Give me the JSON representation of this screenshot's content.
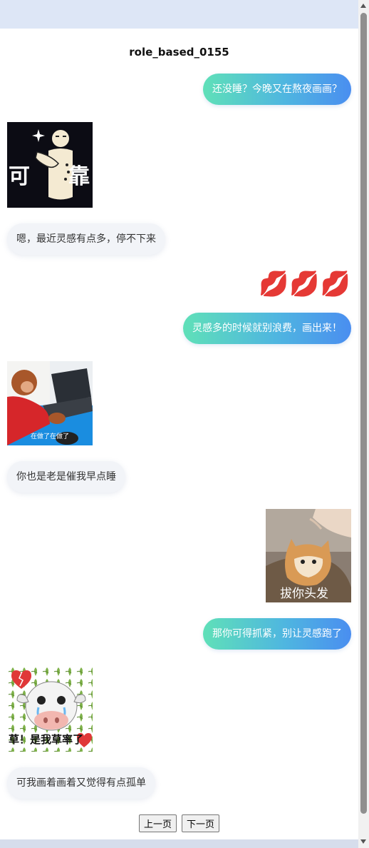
{
  "chat": {
    "title": "role_based_0155",
    "messages": [
      {
        "side": "sent",
        "text": "还没睡？今晚又在熬夜画画？"
      },
      {
        "side": "recv",
        "sticker": "kaopu",
        "caption": "可靠"
      },
      {
        "side": "recv",
        "text": "嗯，最近灵感有点多，停不下来"
      },
      {
        "side": "sent",
        "emoji": "💋💋💋"
      },
      {
        "side": "sent",
        "text": "灵感多的时候就别浪费，画出来！"
      },
      {
        "side": "recv",
        "sticker": "monkey-typing",
        "caption": "在做了在做了"
      },
      {
        "side": "recv",
        "text": "你也是老是催我早点睡"
      },
      {
        "side": "sent",
        "sticker": "cat-hair",
        "caption": "拔你头发"
      },
      {
        "side": "sent",
        "text": "那你可得抓紧，别让灵感跑了"
      },
      {
        "side": "recv",
        "sticker": "cow-crying",
        "caption": "草！是我草率了"
      },
      {
        "side": "recv",
        "text": "可我画着画着又觉得有点孤单"
      }
    ]
  },
  "pager": {
    "prev_label": "上一页",
    "next_label": "下一页"
  },
  "colors": {
    "sent_gradient_start": "#5fe0b8",
    "sent_gradient_end": "#4a8ef0",
    "received_bubble": "#f2f4f8",
    "page_background": "#dfe6f3"
  }
}
